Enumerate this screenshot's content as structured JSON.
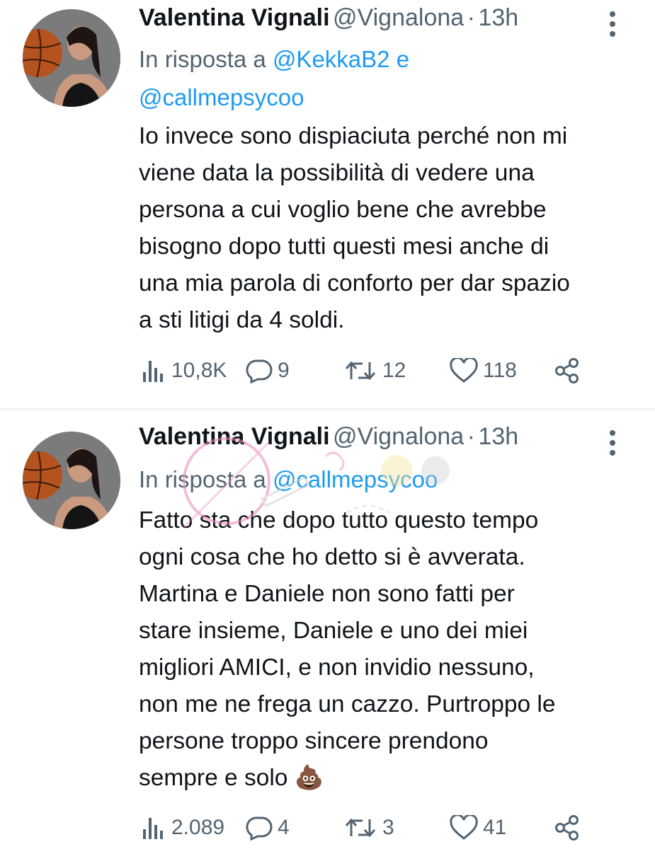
{
  "tweets": [
    {
      "name": "Valentina Vignali",
      "handle": "@Vignalona",
      "separator": "·",
      "time": "13h",
      "reply_prefix": "In risposta a",
      "mentions": [
        "@KekkaB2",
        "@callmepsycoo"
      ],
      "reply_joiner": "e",
      "text": "Io invece sono dispiaciuta perché non mi\nviene data la possibilità di vedere una\npersona a cui voglio bene che avrebbe\nbisogno dopo tutti questi mesi anche di\nuna mia parola di conforto per dar spazio\na sti litigi da 4 soldi.",
      "views": "10,8K",
      "replies": "9",
      "retweets": "12",
      "likes": "118"
    },
    {
      "name": "Valentina Vignali",
      "handle": "@Vignalona",
      "separator": "·",
      "time": "13h",
      "reply_prefix": "In risposta a",
      "mentions": [
        "@callmepsycoo"
      ],
      "text": "Fatto sta che dopo tutto questo tempo\nogni cosa che ho detto si è avverata.\nMartina e Daniele non sono fatti per\nstare insieme, Daniele e uno dei miei\nmigliori AMICI, e non invidio nessuno,\nnon me ne frega un cazzo. Purtroppo le\npersone troppo sincere prendono\nsempre e solo 💩",
      "views": "2.089",
      "replies": "4",
      "retweets": "3",
      "likes": "41"
    }
  ],
  "colors": {
    "text": "#0f1419",
    "secondary": "#536471",
    "link": "#1d9bf0",
    "divider": "#eff3f4"
  }
}
